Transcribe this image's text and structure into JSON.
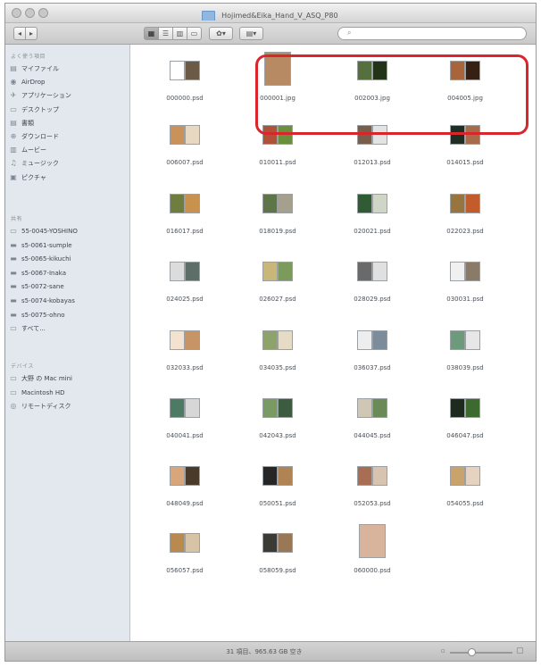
{
  "window": {
    "title": "Hojimed&Eika_Hand_V_ASQ_P80",
    "status": "31 項目、965.63 GB 空き"
  },
  "toolbar": {
    "back_glyph": "◂",
    "forward_glyph": "▸",
    "view_glyphs": [
      "▦",
      "☰",
      "▥",
      "▭"
    ],
    "action_glyph": "✿▾",
    "arrange_glyph": "▤▾",
    "search_placeholder": ""
  },
  "sidebar": {
    "sections": [
      "よく使う項目",
      "共有",
      "デバイス"
    ],
    "favorites": [
      {
        "label": "マイファイル",
        "icon": "all-my-files-icon",
        "glyph": "▤"
      },
      {
        "label": "AirDrop",
        "icon": "airdrop-icon",
        "glyph": "◉"
      },
      {
        "label": "アプリケーション",
        "icon": "applications-icon",
        "glyph": "✈"
      },
      {
        "label": "デスクトップ",
        "icon": "desktop-icon",
        "glyph": "▭"
      },
      {
        "label": "書類",
        "icon": "documents-icon",
        "glyph": "▤"
      },
      {
        "label": "ダウンロード",
        "icon": "downloads-icon",
        "glyph": "⊕"
      },
      {
        "label": "ムービー",
        "icon": "movies-icon",
        "glyph": "▥"
      },
      {
        "label": "ミュージック",
        "icon": "music-icon",
        "glyph": "♫"
      },
      {
        "label": "ピクチャ",
        "icon": "pictures-icon",
        "glyph": "▣"
      }
    ],
    "shared": [
      {
        "label": "55-0045-YOSHINO",
        "icon": "shared-server-icon",
        "glyph": "▭"
      },
      {
        "label": "s5-0061-sumple",
        "icon": "shared-server-icon",
        "glyph": "▬"
      },
      {
        "label": "s5-0065-kikuchi",
        "icon": "shared-server-icon",
        "glyph": "▬"
      },
      {
        "label": "s5-0067-Inaka",
        "icon": "shared-server-icon",
        "glyph": "▬"
      },
      {
        "label": "s5-0072-sane",
        "icon": "shared-server-icon",
        "glyph": "▬"
      },
      {
        "label": "s5-0074-kobayas",
        "icon": "shared-server-icon",
        "glyph": "▬"
      },
      {
        "label": "s5-0075-ohno",
        "icon": "shared-server-icon",
        "glyph": "▬"
      },
      {
        "label": "すべて...",
        "icon": "network-icon",
        "glyph": "▭"
      }
    ],
    "devices": [
      {
        "label": "大野 の Mac mini",
        "icon": "mac-mini-icon",
        "glyph": "▭"
      },
      {
        "label": "Macintosh HD",
        "icon": "hard-disk-icon",
        "glyph": "▭"
      },
      {
        "label": "リモートディスク",
        "icon": "remote-disc-icon",
        "glyph": "◎"
      }
    ]
  },
  "files": [
    {
      "name": "000000.psd",
      "pages": [
        "#ffffff",
        "#6b5a45"
      ]
    },
    {
      "name": "000001.jpg",
      "pages": [
        "#b88a63"
      ]
    },
    {
      "name": "002003.jpg",
      "pages": [
        "#55703d",
        "#223318"
      ]
    },
    {
      "name": "004005.jpg",
      "pages": [
        "#a8653b",
        "#362014"
      ]
    },
    {
      "name": "006007.psd",
      "pages": [
        "#c9925a",
        "#e8d8c2"
      ]
    },
    {
      "name": "010011.psd",
      "pages": [
        "#b05238",
        "#6b8f3a"
      ]
    },
    {
      "name": "012013.psd",
      "pages": [
        "#7a5e4a",
        "#e3e3e3"
      ]
    },
    {
      "name": "014015.psd",
      "pages": [
        "#1f2e22",
        "#a86b4a"
      ]
    },
    {
      "name": "016017.psd",
      "pages": [
        "#6f7d3f",
        "#c8914e"
      ]
    },
    {
      "name": "018019.psd",
      "pages": [
        "#5e7548",
        "#a5a08e"
      ]
    },
    {
      "name": "020021.psd",
      "pages": [
        "#2f5c33",
        "#cfd6c6"
      ]
    },
    {
      "name": "022023.psd",
      "pages": [
        "#98753f",
        "#c25d2b"
      ]
    },
    {
      "name": "024025.psd",
      "pages": [
        "#dcdcdc",
        "#5d6e68"
      ]
    },
    {
      "name": "026027.psd",
      "pages": [
        "#c9b77a",
        "#7b9a5c"
      ]
    },
    {
      "name": "028029.psd",
      "pages": [
        "#6a6a6a",
        "#e0e0e0"
      ]
    },
    {
      "name": "030031.psd",
      "pages": [
        "#f0f0f0",
        "#8a7a68"
      ]
    },
    {
      "name": "032033.psd",
      "pages": [
        "#f2e2cf",
        "#c79465"
      ]
    },
    {
      "name": "034035.psd",
      "pages": [
        "#8da36a",
        "#e6dcc6"
      ]
    },
    {
      "name": "036037.psd",
      "pages": [
        "#eeeeee",
        "#7d8c9a"
      ]
    },
    {
      "name": "038039.psd",
      "pages": [
        "#6d9a7a",
        "#e7e7e7"
      ]
    },
    {
      "name": "040041.psd",
      "pages": [
        "#4d7a63",
        "#d7d7d7"
      ]
    },
    {
      "name": "042043.psd",
      "pages": [
        "#7a9a63",
        "#3c5c3f"
      ]
    },
    {
      "name": "044045.psd",
      "pages": [
        "#cfc7b3",
        "#6a8a58"
      ]
    },
    {
      "name": "046047.psd",
      "pages": [
        "#1e2a1e",
        "#3d6a2e"
      ]
    },
    {
      "name": "048049.psd",
      "pages": [
        "#d9a57a",
        "#4a3a2a"
      ]
    },
    {
      "name": "050051.psd",
      "pages": [
        "#262626",
        "#b08355"
      ]
    },
    {
      "name": "052053.psd",
      "pages": [
        "#a86e54",
        "#d8c2b0"
      ]
    },
    {
      "name": "054055.psd",
      "pages": [
        "#c9a36b",
        "#e6d2c0"
      ]
    },
    {
      "name": "056057.psd",
      "pages": [
        "#b88a4e",
        "#d7c4a6"
      ]
    },
    {
      "name": "058059.psd",
      "pages": [
        "#3b3a34",
        "#9b7855"
      ]
    },
    {
      "name": "060000.psd",
      "pages": [
        "#d8b49c"
      ]
    }
  ],
  "colors": {
    "highlight": "#d9262c",
    "sidebar_bg": "#e3e8ee"
  }
}
